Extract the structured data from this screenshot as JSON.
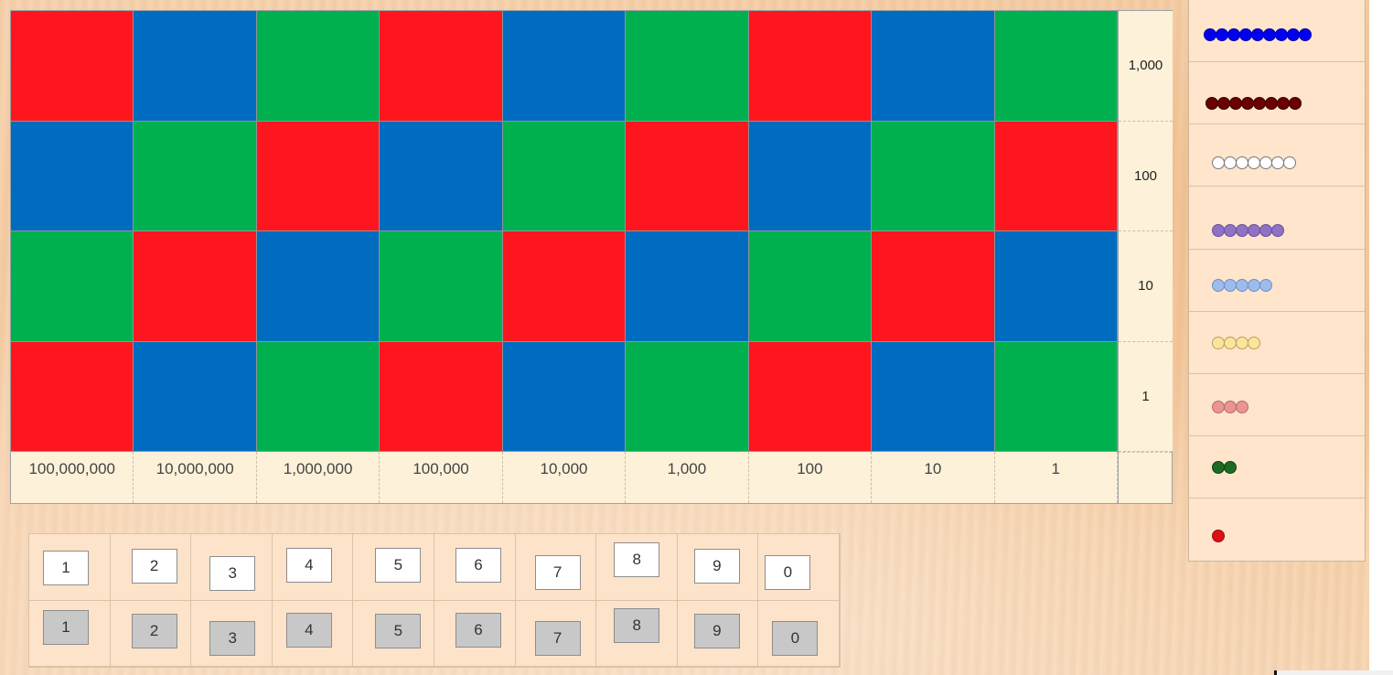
{
  "board": {
    "colors": {
      "red": "#fe161e",
      "blue": "#006cc0",
      "green": "#00b04f"
    },
    "rows": [
      [
        "red",
        "blue",
        "green",
        "red",
        "blue",
        "green",
        "red",
        "blue",
        "green"
      ],
      [
        "blue",
        "green",
        "red",
        "blue",
        "green",
        "red",
        "blue",
        "green",
        "red"
      ],
      [
        "green",
        "red",
        "blue",
        "green",
        "red",
        "blue",
        "green",
        "red",
        "blue"
      ],
      [
        "red",
        "blue",
        "green",
        "red",
        "blue",
        "green",
        "red",
        "blue",
        "green"
      ]
    ],
    "row_labels": [
      "1,000",
      "100",
      "10",
      "1"
    ],
    "column_labels": [
      "100,000,000",
      "10,000,000",
      "1,000,000",
      "100,000",
      "10,000",
      "1,000",
      "100",
      "10",
      "1"
    ]
  },
  "bead_bars": [
    {
      "count": 9,
      "color": "#0000ee",
      "border": "#0000aa"
    },
    {
      "count": 8,
      "color": "#6a0000",
      "border": "#3a0000"
    },
    {
      "count": 7,
      "color": "#ffffff",
      "border": "#777777"
    },
    {
      "count": 6,
      "color": "#9072c4",
      "border": "#6b4f9e"
    },
    {
      "count": 5,
      "color": "#9dbcee",
      "border": "#6f8fc4"
    },
    {
      "count": 4,
      "color": "#fbe59a",
      "border": "#b9a060"
    },
    {
      "count": 3,
      "color": "#eb9496",
      "border": "#b86a6c"
    },
    {
      "count": 2,
      "color": "#1e6b23",
      "border": "#124515"
    },
    {
      "count": 1,
      "color": "#dd1111",
      "border": "#991111"
    }
  ],
  "cards": {
    "white": [
      "1",
      "2",
      "3",
      "4",
      "5",
      "6",
      "7",
      "8",
      "9",
      "0"
    ],
    "gray": [
      "1",
      "2",
      "3",
      "4",
      "5",
      "6",
      "7",
      "8",
      "9",
      "0"
    ]
  }
}
